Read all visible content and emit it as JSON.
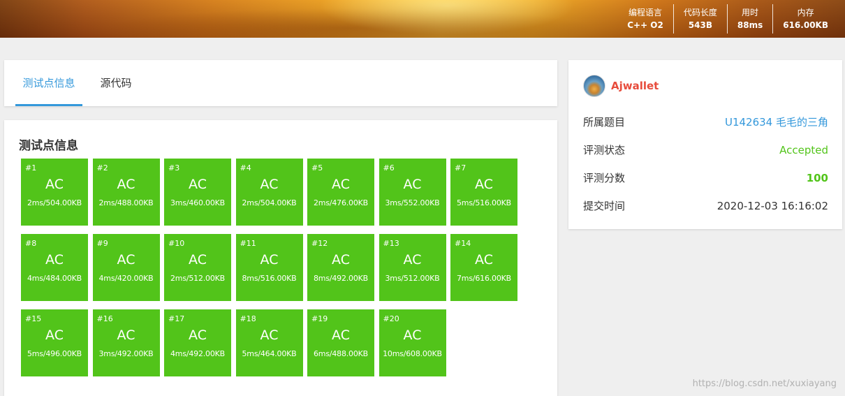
{
  "banner": {
    "stats": [
      {
        "label": "编程语言",
        "value": "C++ O2"
      },
      {
        "label": "代码长度",
        "value": "543B"
      },
      {
        "label": "用时",
        "value": "88ms"
      },
      {
        "label": "内存",
        "value": "616.00KB"
      }
    ]
  },
  "tabs": [
    {
      "label": "测试点信息",
      "active": true
    },
    {
      "label": "源代码",
      "active": false
    }
  ],
  "tests": {
    "title": "测试点信息",
    "cases": [
      {
        "id": "#1",
        "status": "AC",
        "meta": "2ms/504.00KB"
      },
      {
        "id": "#2",
        "status": "AC",
        "meta": "2ms/488.00KB"
      },
      {
        "id": "#3",
        "status": "AC",
        "meta": "3ms/460.00KB"
      },
      {
        "id": "#4",
        "status": "AC",
        "meta": "2ms/504.00KB"
      },
      {
        "id": "#5",
        "status": "AC",
        "meta": "2ms/476.00KB"
      },
      {
        "id": "#6",
        "status": "AC",
        "meta": "3ms/552.00KB"
      },
      {
        "id": "#7",
        "status": "AC",
        "meta": "5ms/516.00KB"
      },
      {
        "id": "#8",
        "status": "AC",
        "meta": "4ms/484.00KB"
      },
      {
        "id": "#9",
        "status": "AC",
        "meta": "4ms/420.00KB"
      },
      {
        "id": "#10",
        "status": "AC",
        "meta": "2ms/512.00KB"
      },
      {
        "id": "#11",
        "status": "AC",
        "meta": "8ms/516.00KB"
      },
      {
        "id": "#12",
        "status": "AC",
        "meta": "8ms/492.00KB"
      },
      {
        "id": "#13",
        "status": "AC",
        "meta": "3ms/512.00KB"
      },
      {
        "id": "#14",
        "status": "AC",
        "meta": "7ms/616.00KB"
      },
      {
        "id": "#15",
        "status": "AC",
        "meta": "5ms/496.00KB"
      },
      {
        "id": "#16",
        "status": "AC",
        "meta": "3ms/492.00KB"
      },
      {
        "id": "#17",
        "status": "AC",
        "meta": "4ms/492.00KB"
      },
      {
        "id": "#18",
        "status": "AC",
        "meta": "5ms/464.00KB"
      },
      {
        "id": "#19",
        "status": "AC",
        "meta": "6ms/488.00KB"
      },
      {
        "id": "#20",
        "status": "AC",
        "meta": "10ms/608.00KB"
      }
    ]
  },
  "info": {
    "username": "Ajwallet",
    "rows": [
      {
        "label": "所属题目",
        "value": "U142634 毛毛的三角"
      },
      {
        "label": "评测状态",
        "value": "Accepted"
      },
      {
        "label": "评测分数",
        "value": "100"
      },
      {
        "label": "提交时间",
        "value": "2020-12-03 16:16:02"
      }
    ]
  },
  "watermark": "https://blog.csdn.net/xuxiayang",
  "colors": {
    "accent": "#3498db",
    "ac_green": "#52c41a",
    "username": "#e74c3c"
  }
}
